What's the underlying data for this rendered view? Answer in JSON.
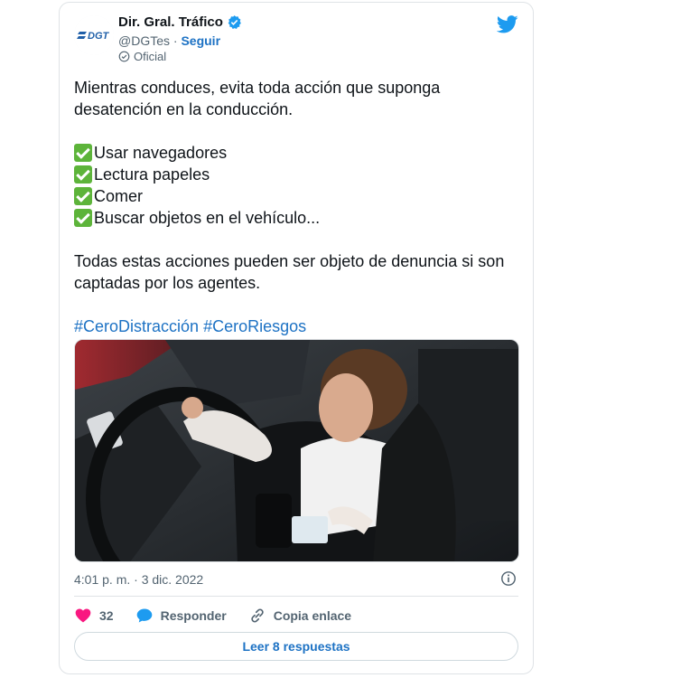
{
  "account": {
    "display_name": "Dir. Gral. Tráfico",
    "handle": "@DGTes",
    "separator": " · ",
    "follow_label": "Seguir",
    "official_label": "Oficial",
    "avatar_text": "DGT"
  },
  "tweet": {
    "intro": "Mientras conduces, evita toda acción que suponga desatención en la conducción.",
    "checklist": [
      "Usar navegadores",
      "Lectura papeles",
      "Comer",
      "Buscar objetos en el vehículo..."
    ],
    "closing": "Todas estas acciones pueden ser objeto de denuncia si son captadas por los agentes.",
    "hashtags": [
      "#CeroDistracción",
      "#CeroRiesgos"
    ]
  },
  "meta": {
    "timestamp": "4:01 p. m. · 3 dic. 2022"
  },
  "actions": {
    "like_count": "32",
    "reply_label": "Responder",
    "copy_label": "Copia enlace",
    "read_replies_label": "Leer 8 respuestas"
  },
  "icons": [
    "verified-icon",
    "twitter-logo-icon",
    "official-icon",
    "check-icon",
    "info-icon",
    "heart-icon",
    "reply-icon",
    "link-icon"
  ],
  "colors": {
    "accent": "#1d9bf0",
    "link": "#1d72c4",
    "like": "#f91880",
    "check": "#5db43a"
  }
}
